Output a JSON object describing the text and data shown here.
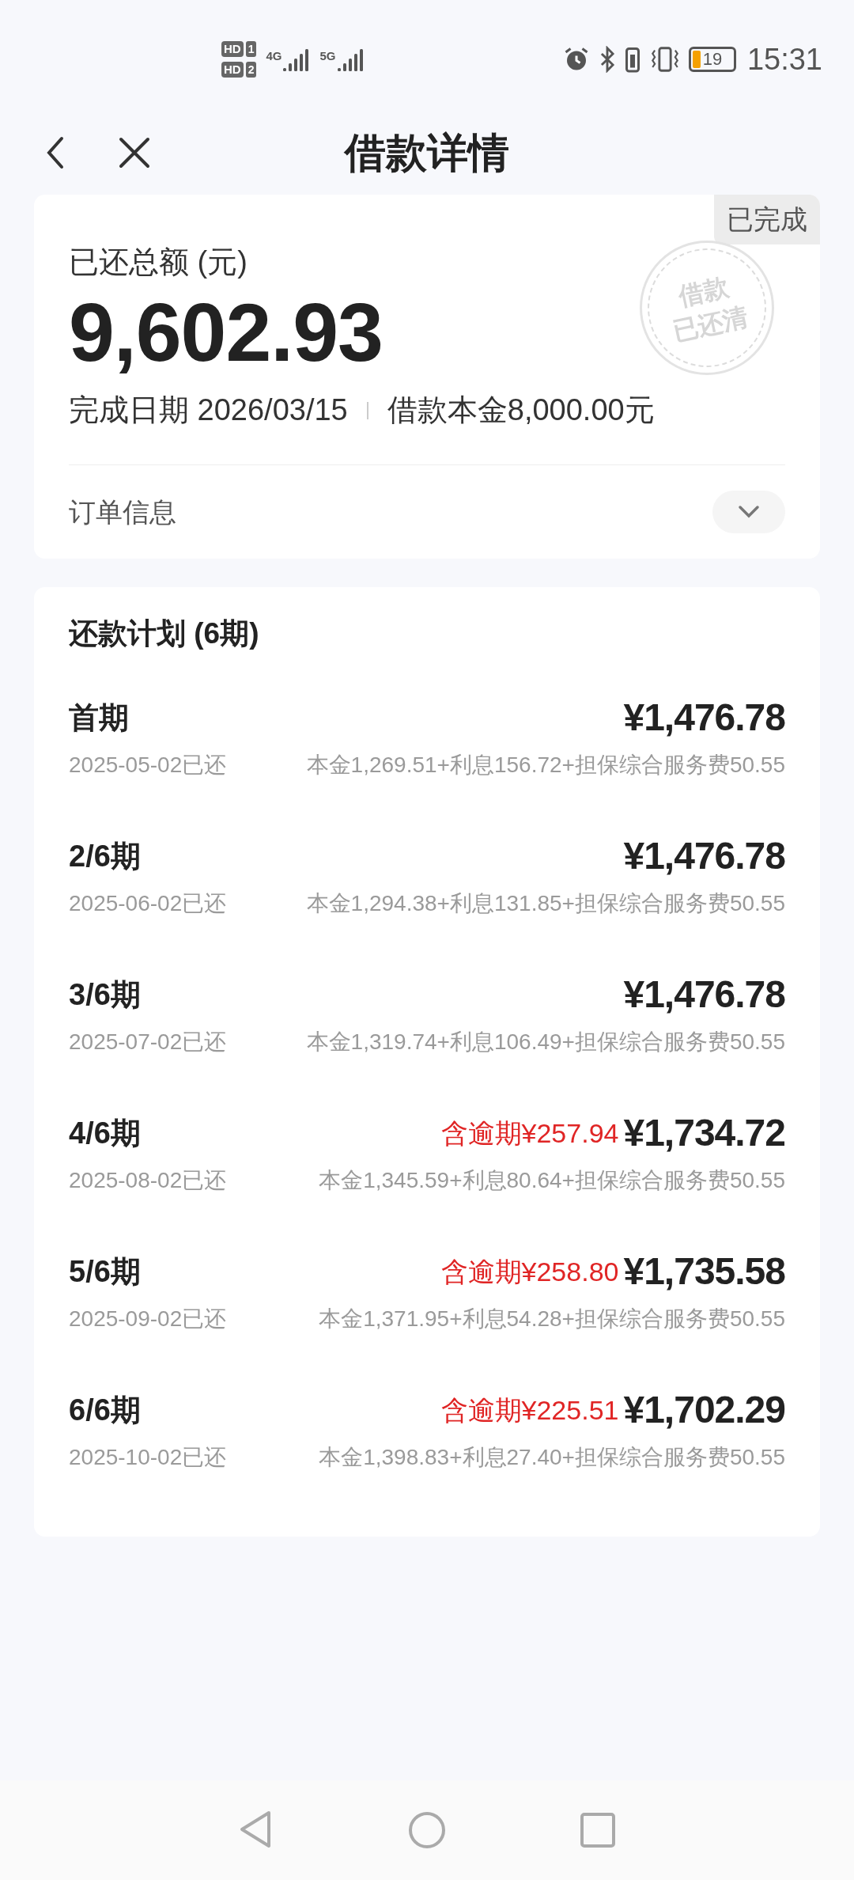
{
  "status_bar": {
    "sims": [
      {
        "badge": "HD",
        "slot": "1"
      },
      {
        "badge": "HD",
        "slot": "2"
      }
    ],
    "networks": [
      "4G",
      "5G"
    ],
    "battery": "19",
    "time": "15:31"
  },
  "header": {
    "title": "借款详情"
  },
  "summary": {
    "badge": "已完成",
    "label": "已还总额 (元)",
    "amount": "9,602.93",
    "stamp": [
      "借款",
      "已还清"
    ],
    "completion_date": "完成日期 2026/03/15",
    "principal": "借款本金8,000.00元",
    "order_info": "订单信息",
    "expanded": false
  },
  "schedule": {
    "title": "还款计划 (6期)",
    "installments": [
      {
        "period": "首期",
        "amount": "¥1,476.78",
        "paid_date": "2025-05-02已还",
        "breakdown": "本金1,269.51+利息156.72+担保综合服务费50.55"
      },
      {
        "period": "2/6期",
        "amount": "¥1,476.78",
        "paid_date": "2025-06-02已还",
        "breakdown": "本金1,294.38+利息131.85+担保综合服务费50.55"
      },
      {
        "period": "3/6期",
        "amount": "¥1,476.78",
        "paid_date": "2025-07-02已还",
        "breakdown": "本金1,319.74+利息106.49+担保综合服务费50.55"
      },
      {
        "period": "4/6期",
        "overdue": "含逾期¥257.94",
        "amount": "¥1,734.72",
        "paid_date": "2025-08-02已还",
        "breakdown": "本金1,345.59+利息80.64+担保综合服务费50.55"
      },
      {
        "period": "5/6期",
        "overdue": "含逾期¥258.80",
        "amount": "¥1,735.58",
        "paid_date": "2025-09-02已还",
        "breakdown": "本金1,371.95+利息54.28+担保综合服务费50.55"
      },
      {
        "period": "6/6期",
        "overdue": "含逾期¥225.51",
        "amount": "¥1,702.29",
        "paid_date": "2025-10-02已还",
        "breakdown": "本金1,398.83+利息27.40+担保综合服务费50.55"
      }
    ]
  }
}
